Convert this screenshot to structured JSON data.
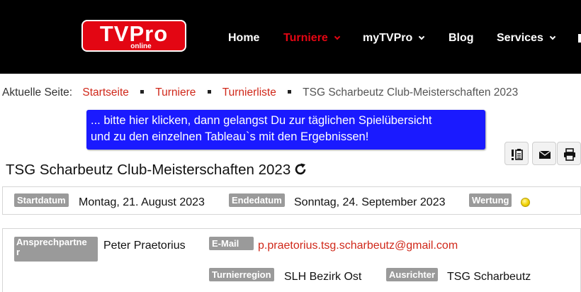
{
  "header": {
    "logo": {
      "main": "TVPro",
      "sub": "online"
    },
    "nav": [
      {
        "label": "Home",
        "dropdown": false,
        "active": false
      },
      {
        "label": "Turniere",
        "dropdown": true,
        "active": true
      },
      {
        "label": "myTVPro",
        "dropdown": true,
        "active": false
      },
      {
        "label": "Blog",
        "dropdown": false,
        "active": false
      },
      {
        "label": "Services",
        "dropdown": true,
        "active": false
      }
    ]
  },
  "breadcrumb": {
    "label": "Aktuelle Seite:",
    "items": [
      "Startseite",
      "Turniere",
      "Turnierliste"
    ],
    "current": "TSG Scharbeutz Club-Meisterschaften 2023"
  },
  "banner": {
    "line1": "... bitte hier klicken, dann gelangst Du zur täglichen Spielübersicht",
    "line2": "und zu den einzelnen Tableau`s mit den Ergebnissen!"
  },
  "toolbar": {
    "icons": [
      "notice-list-icon",
      "envelope-icon",
      "printer-icon"
    ]
  },
  "tournament": {
    "title": "TSG Scharbeutz Club-Meisterschaften 2023",
    "dates": {
      "start_label": "Startdatum",
      "start_value": "Montag, 21. August 2023",
      "end_label": "Endedatum",
      "end_value": "Sonntag, 24. September 2023",
      "rating_label": "Wertung"
    },
    "contact": {
      "person_label_line1": "Ansprechpartne",
      "person_label_line2": "r",
      "person_value": "Peter Praetorius",
      "email_label": "E-Mail",
      "email_value": "p.praetorius.tsg.scharbeutz@gmail.com",
      "region_label": "Turnierregion",
      "region_value": "SLH Bezirk Ost",
      "organizer_label": "Ausrichter",
      "organizer_value": "TSG Scharbeutz"
    }
  },
  "colors": {
    "header_bg": "#000000",
    "brand_red": "#e30613",
    "link_red": "#d0281a",
    "banner_blue": "#1a1aff",
    "label_gray": "#9a9a9a",
    "rating_yellow": "#f1d200"
  }
}
